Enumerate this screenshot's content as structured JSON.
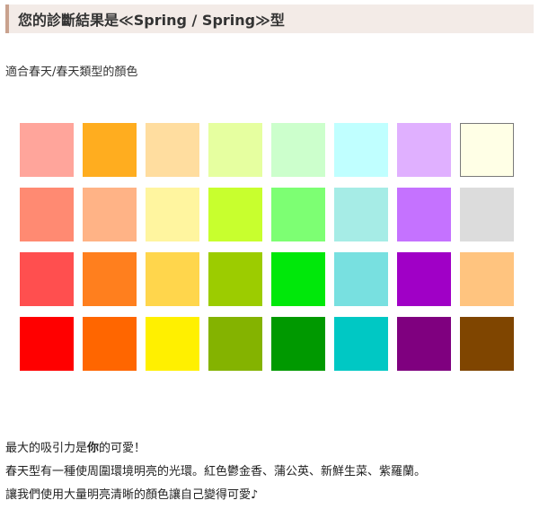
{
  "header": {
    "title": "您的診斷結果是≪Spring / Spring≫型"
  },
  "subtitle": "適合春天/春天類型的顏色",
  "palette": {
    "rows": [
      [
        "#ffa59b",
        "#ffad1f",
        "#ffdd9f",
        "#e6ffa0",
        "#ccffcc",
        "#c0ffff",
        "#e0b0ff",
        "#ffffe6"
      ],
      [
        "#ff8a72",
        "#ffb386",
        "#fff59f",
        "#c8ff2e",
        "#7dff73",
        "#a6ece6",
        "#c572ff",
        "#dcdcdc"
      ],
      [
        "#ff4f4f",
        "#ff7f1e",
        "#ffd64c",
        "#9ccc00",
        "#00e80a",
        "#78e0e0",
        "#a000c6",
        "#ffc47f"
      ],
      [
        "#ff0000",
        "#ff6600",
        "#fff000",
        "#84b300",
        "#009900",
        "#00c8c4",
        "#7f007f",
        "#7f4500"
      ]
    ],
    "outlined": [
      [
        0,
        7
      ]
    ]
  },
  "description": {
    "line1_prefix": "最大的吸引力是",
    "line1_bold": "你",
    "line1_suffix": "的可愛！",
    "line2": "春天型有一種使周圍環境明亮的光環。紅色鬱金香、蒲公英、新鮮生菜、紫羅蘭。",
    "line3": "讓我們使用大量明亮清晰的顏色讓自己變得可愛♪"
  }
}
